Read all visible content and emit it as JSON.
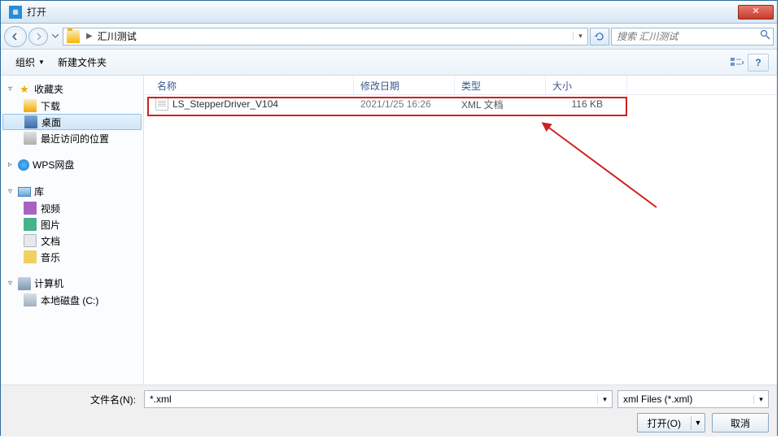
{
  "window": {
    "title": "打开"
  },
  "nav": {
    "path": "汇川测试",
    "search_placeholder": "搜索 汇川测试"
  },
  "toolbar": {
    "organize": "组织",
    "new_folder": "新建文件夹"
  },
  "sidebar": {
    "favorites": {
      "label": "收藏夹",
      "items": [
        {
          "label": "下载"
        },
        {
          "label": "桌面"
        },
        {
          "label": "最近访问的位置"
        }
      ]
    },
    "wps": {
      "label": "WPS网盘"
    },
    "libraries": {
      "label": "库",
      "items": [
        {
          "label": "视频"
        },
        {
          "label": "图片"
        },
        {
          "label": "文档"
        },
        {
          "label": "音乐"
        }
      ]
    },
    "computer": {
      "label": "计算机",
      "items": [
        {
          "label": "本地磁盘 (C:)"
        }
      ]
    }
  },
  "columns": {
    "name": "名称",
    "date": "修改日期",
    "type": "类型",
    "size": "大小"
  },
  "files": [
    {
      "name": "LS_StepperDriver_V104",
      "date": "2021/1/25 16:26",
      "type": "XML 文档",
      "size": "116 KB"
    }
  ],
  "bottom": {
    "filename_label": "文件名(N):",
    "filename_value": "*.xml",
    "filter": "xml Files (*.xml)",
    "open": "打开(O)",
    "cancel": "取消"
  }
}
